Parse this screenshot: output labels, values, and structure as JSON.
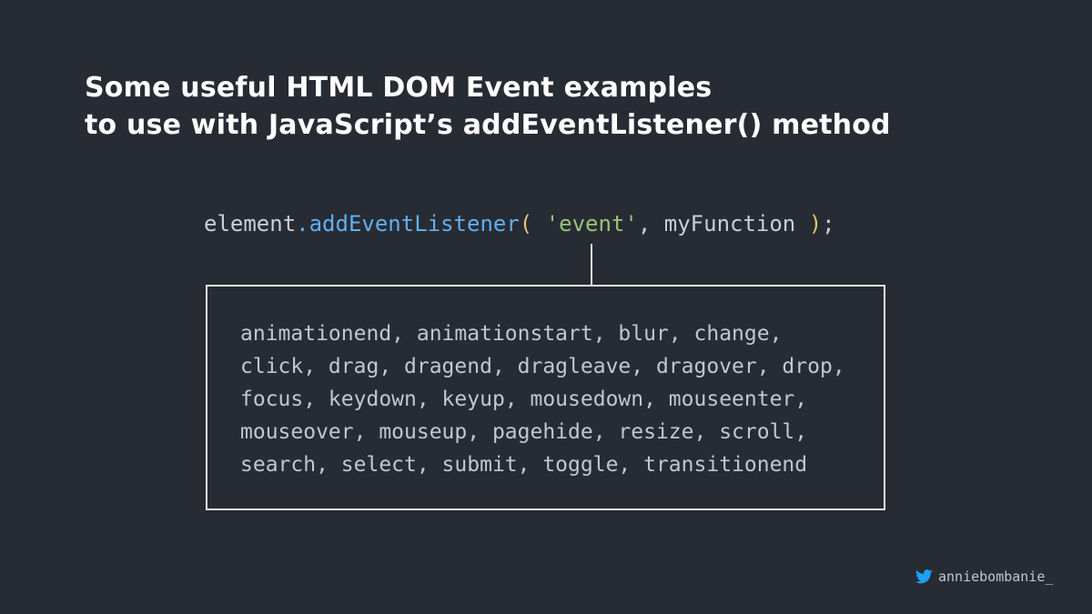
{
  "title": {
    "line1": "Some useful HTML DOM Event examples",
    "line2": "to use with JavaScript’s addEventListener() method"
  },
  "code": {
    "object": "element",
    "dot": ".",
    "method": "addEventListener",
    "open_paren": "(",
    "space1": " ",
    "string": "'event'",
    "comma": ", ",
    "arg": "myFunction",
    "space2": " ",
    "close_paren": ")",
    "semicolon": ";"
  },
  "events": {
    "lines": [
      "animationend, animationstart, blur, change,",
      "click, drag, dragend, dragleave, dragover, drop,",
      "focus, keydown, keyup, mousedown, mouseenter,",
      "mouseover, mouseup, pagehide, resize, scroll,",
      "search, select, submit, toggle, transitionend"
    ]
  },
  "credit": {
    "icon": "twitter-bird-icon",
    "handle": "anniebombanie_"
  },
  "colors": {
    "background": "#272b33",
    "title": "#ffffff",
    "code_text": "#c9ced6",
    "method": "#61afef",
    "paren": "#e5c07b",
    "string": "#98c379",
    "twitter": "#1da1f2"
  }
}
